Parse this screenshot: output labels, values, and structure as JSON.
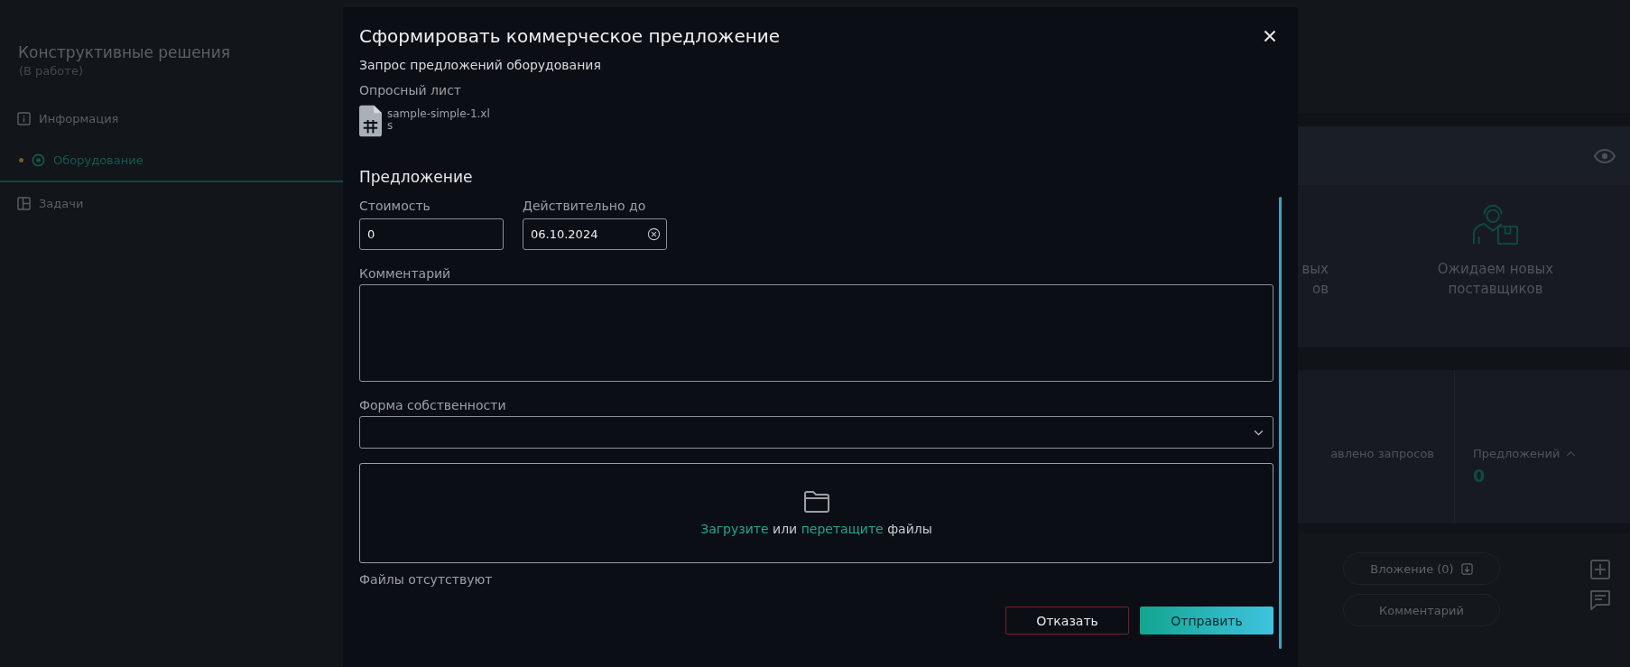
{
  "sidebar": {
    "title": "Конструктивные решения",
    "subtitle": "(В работе)",
    "items": [
      {
        "label": "Информация",
        "selected": false,
        "marked": false
      },
      {
        "label": "Оборудование",
        "selected": true,
        "marked": true
      },
      {
        "label": "Задачи",
        "selected": false,
        "marked": false
      }
    ]
  },
  "background": {
    "status_card": {
      "partial_label_lines": [
        "вых",
        "ов"
      ],
      "waiting_label": "Ожидаем новых поставщиков"
    },
    "stats_card": {
      "partial_label": "авлено запросов",
      "offers_label": "Предложений",
      "offers_value": "0"
    },
    "pills": [
      "Вложение (0)",
      "Комментарий"
    ]
  },
  "modal": {
    "title": "Сформировать коммерческое предложение",
    "request_title": "Запрос предложений оборудования",
    "questionnaire_label": "Опросный лист",
    "file_name": "sample-simple-1.xls",
    "section_title": "Предложение",
    "cost": {
      "label": "Стоимость",
      "value": "0"
    },
    "valid_until": {
      "label": "Действительно до",
      "value": "06.10.2024"
    },
    "comment": {
      "label": "Комментарий"
    },
    "ownership": {
      "label": "Форма собственности"
    },
    "dropzone": {
      "upload_link": "Загрузите",
      "middle": "или",
      "drag_link": "перетащите",
      "end": "файлы"
    },
    "files_note": "Файлы отсутствуют",
    "buttons": [
      {
        "label": "Отказать",
        "kind": "reject"
      },
      {
        "label": "Отправить",
        "kind": "submit"
      }
    ]
  }
}
